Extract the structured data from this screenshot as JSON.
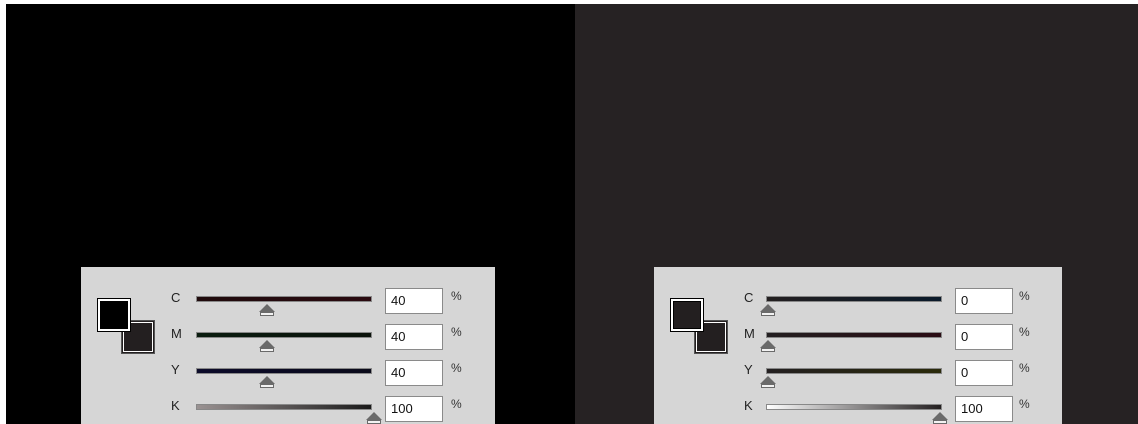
{
  "left_panel": {
    "percent": "%",
    "channels": [
      {
        "label": "C",
        "value": "40",
        "level": 40
      },
      {
        "label": "M",
        "value": "40",
        "level": 40
      },
      {
        "label": "Y",
        "value": "40",
        "level": 40
      },
      {
        "label": "K",
        "value": "100",
        "level": 100
      }
    ],
    "colors": {
      "canvas": "#000000",
      "fill": "#000000",
      "stroke": "#231f20"
    }
  },
  "right_panel": {
    "percent": "%",
    "channels": [
      {
        "label": "C",
        "value": "0",
        "level": 0
      },
      {
        "label": "M",
        "value": "0",
        "level": 0
      },
      {
        "label": "Y",
        "value": "0",
        "level": 0
      },
      {
        "label": "K",
        "value": "100",
        "level": 100
      }
    ],
    "colors": {
      "canvas": "#262223",
      "fill": "#231f20",
      "stroke": "#231f20"
    }
  }
}
